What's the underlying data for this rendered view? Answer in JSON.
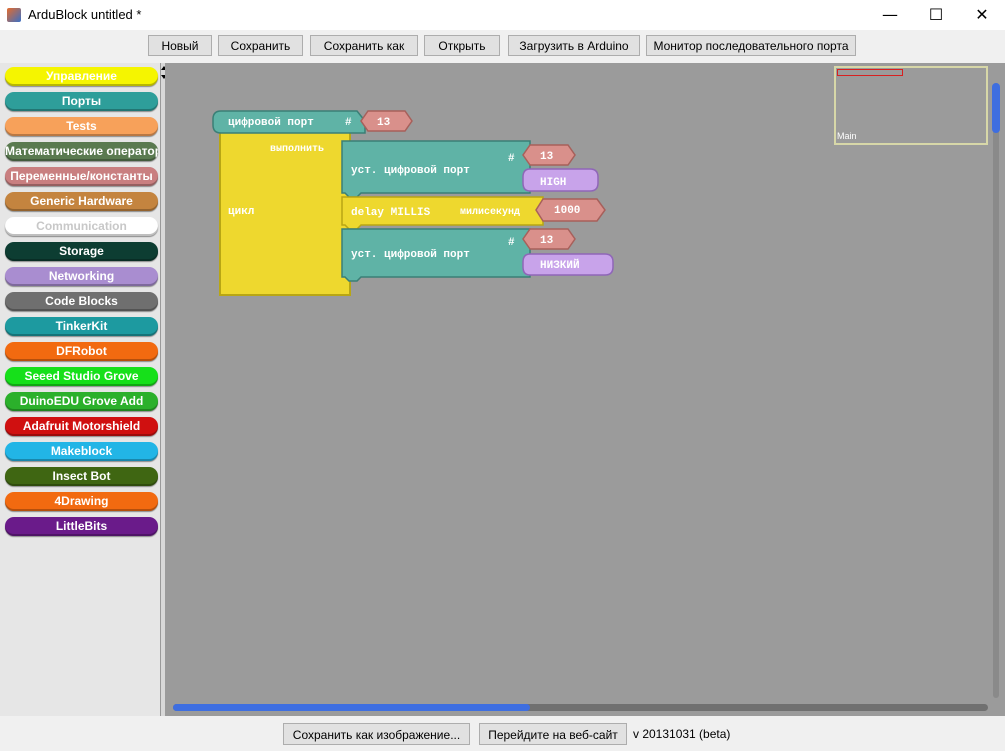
{
  "window": {
    "title": "ArduBlock untitled *",
    "minimize_glyph": "—",
    "maximize_glyph": "☐",
    "close_glyph": "✕"
  },
  "toolbar": {
    "new": "Новый",
    "save": "Сохранить",
    "save_as": "Сохранить как",
    "open": "Открыть",
    "upload": "Загрузить в Arduino",
    "serial_monitor": "Монитор последовательного порта"
  },
  "palette": {
    "categories": [
      {
        "label": "Управление",
        "color": "#f5f500",
        "text": "#ffffff"
      },
      {
        "label": "Порты",
        "color": "#2e9e9a",
        "text": "#ffffff"
      },
      {
        "label": "Tests",
        "color": "#f7a15a",
        "text": "#ffffff"
      },
      {
        "label": "Математические операторы",
        "color": "#5a7a50",
        "text": "#ffffff"
      },
      {
        "label": "Переменные/константы",
        "color": "#c97f80",
        "text": "#ffffff"
      },
      {
        "label": "Generic Hardware",
        "color": "#c4843f",
        "text": "#ffffff"
      },
      {
        "label": "Communication",
        "color": "#ffffff",
        "text": "#c8c8c8"
      },
      {
        "label": "Storage",
        "color": "#0d3d32",
        "text": "#ffffff"
      },
      {
        "label": "Networking",
        "color": "#a98dd0",
        "text": "#ffffff"
      },
      {
        "label": "Code Blocks",
        "color": "#6f6f6f",
        "text": "#ffffff"
      },
      {
        "label": "TinkerKit",
        "color": "#1d9aa0",
        "text": "#ffffff"
      },
      {
        "label": "DFRobot",
        "color": "#f26a10",
        "text": "#ffffff"
      },
      {
        "label": "Seeed Studio Grove",
        "color": "#16e01a",
        "text": "#ffffff"
      },
      {
        "label": "DuinoEDU Grove Add",
        "color": "#2bb02b",
        "text": "#ffffff"
      },
      {
        "label": "Adafruit Motorshield",
        "color": "#d01010",
        "text": "#ffffff"
      },
      {
        "label": "Makeblock",
        "color": "#22b5e6",
        "text": "#ffffff"
      },
      {
        "label": "Insect Bot",
        "color": "#3f6612",
        "text": "#ffffff"
      },
      {
        "label": "4Drawing",
        "color": "#f26a10",
        "text": "#ffffff"
      },
      {
        "label": "LittleBits",
        "color": "#6a1b8a",
        "text": "#ffffff"
      }
    ]
  },
  "blocks": {
    "var_block": {
      "label": "цифровой порт",
      "hash": "#",
      "value": "13"
    },
    "loop": {
      "label": "цикл",
      "do_label": "выполнить"
    },
    "set_pin_1": {
      "label": "уст. цифровой порт",
      "hash": "#",
      "pin": "13",
      "state": "HIGH"
    },
    "delay": {
      "label": "delay MILLIS",
      "unit": "милисекунд",
      "value": "1000"
    },
    "set_pin_2": {
      "label": "уст. цифровой порт",
      "hash": "#",
      "pin": "13",
      "state": "НИЗКИЙ"
    }
  },
  "minimap": {
    "label": "Main"
  },
  "bottom": {
    "save_image": "Сохранить как изображение...",
    "website": "Перейдите на веб-сайт",
    "version": "v 20131031 (beta)"
  },
  "colors": {
    "teal_block": "#5fb3a6",
    "yellow_block": "#eed82e",
    "purple_value": "#c8a3ea",
    "pink_value": "#d9908b"
  }
}
